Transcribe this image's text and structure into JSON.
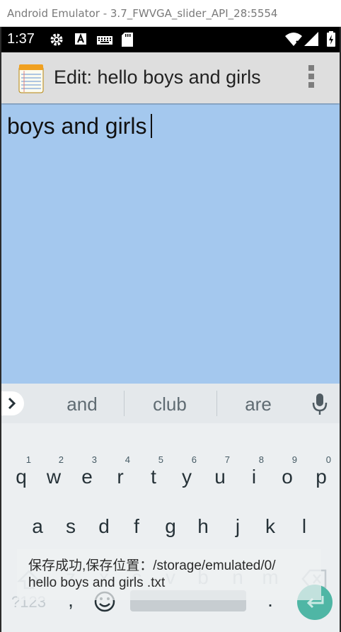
{
  "window": {
    "title": "Android Emulator - 3.7_FWVGA_slider_API_28:5554"
  },
  "status_bar": {
    "time": "1:37",
    "icons": [
      "gear-icon",
      "a-icon",
      "keyboard-icon",
      "sd-card-icon",
      "wifi-icon",
      "signal-icon",
      "battery-icon"
    ]
  },
  "action_bar": {
    "title": "Edit: hello boys and girls",
    "app_icon": "notepad-icon",
    "menu_icon": "overflow-menu-icon"
  },
  "editor": {
    "text": "boys and girls"
  },
  "keyboard": {
    "suggestions": [
      "and",
      "club",
      "are"
    ],
    "row1": [
      {
        "k": "q",
        "h": "1"
      },
      {
        "k": "w",
        "h": "2"
      },
      {
        "k": "e",
        "h": "3"
      },
      {
        "k": "r",
        "h": "4"
      },
      {
        "k": "t",
        "h": "5"
      },
      {
        "k": "y",
        "h": "6"
      },
      {
        "k": "u",
        "h": "7"
      },
      {
        "k": "i",
        "h": "8"
      },
      {
        "k": "o",
        "h": "9"
      },
      {
        "k": "p",
        "h": "0"
      }
    ],
    "row2": [
      "a",
      "s",
      "d",
      "f",
      "g",
      "h",
      "j",
      "k",
      "l"
    ],
    "row3": [
      "z",
      "x",
      "c",
      "v",
      "b",
      "n",
      "m"
    ],
    "bottom": {
      "sym_label": "?123",
      "comma": ",",
      "period": "."
    }
  },
  "toast": {
    "line1": "保存成功,保存位置：/storage/emulated/0/",
    "line2": "hello boys and girls .txt"
  },
  "colors": {
    "editor_bg": "#a4c8ee",
    "action_bar": "#dedede",
    "keyboard_bg": "#eceff1",
    "enter_key": "#4fb6a5"
  }
}
